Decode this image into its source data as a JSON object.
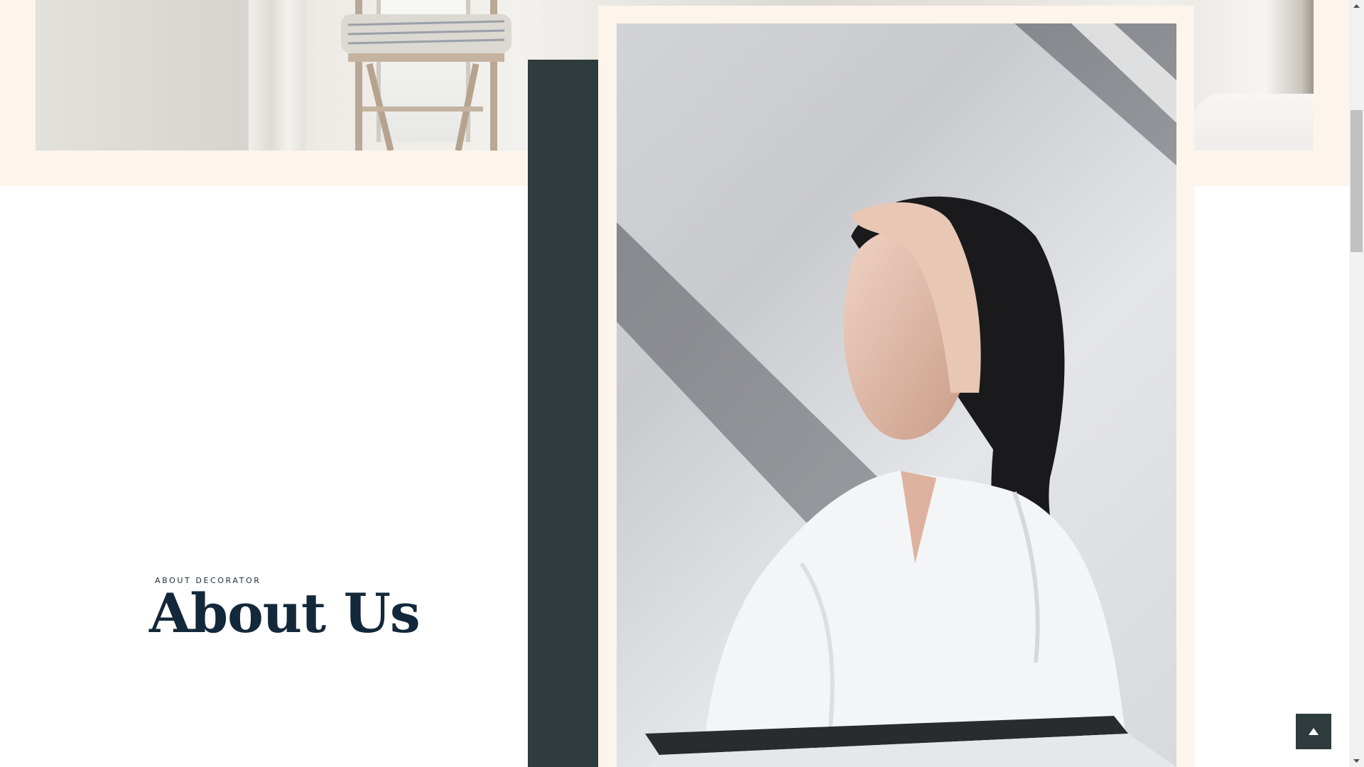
{
  "about": {
    "eyebrow": "ABOUT DECORATOR",
    "heading": "About Us"
  },
  "images": {
    "gallery": "interior-gallery-image",
    "portrait": "woman-portrait-image"
  },
  "back_to_top": {
    "icon": "chevron-up-icon"
  },
  "colors": {
    "cream": "#fdf5ec",
    "dark_green": "#2f3b3c",
    "heading": "#13283a"
  }
}
